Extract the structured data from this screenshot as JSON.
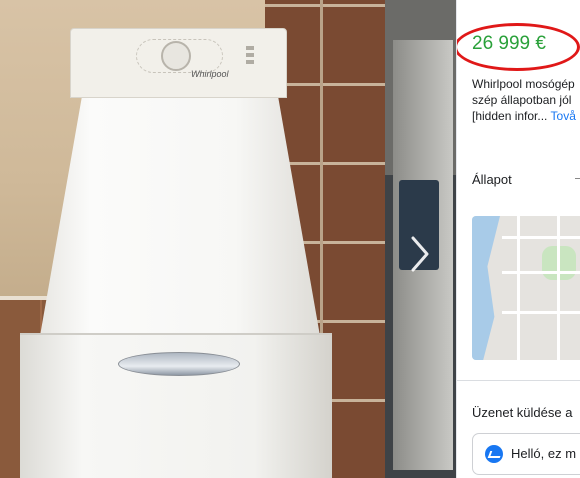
{
  "listing": {
    "price": "26 999 €",
    "description_lines": [
      "Whirlpool mosógép",
      "szép állapotban jól",
      "[hidden infor..."
    ],
    "more_link": "Tovå",
    "condition_label": "Állapot",
    "message_title": "Üzenet küldése a",
    "message_placeholder": "Helló, ez m"
  },
  "photo": {
    "brand_logo": "Whirlpool"
  },
  "icons": {
    "next": "chevron-right-icon",
    "messenger": "messenger-icon"
  },
  "colors": {
    "price": "#2aa13a",
    "highlight_circle": "#e01818",
    "link": "#1877f2"
  }
}
